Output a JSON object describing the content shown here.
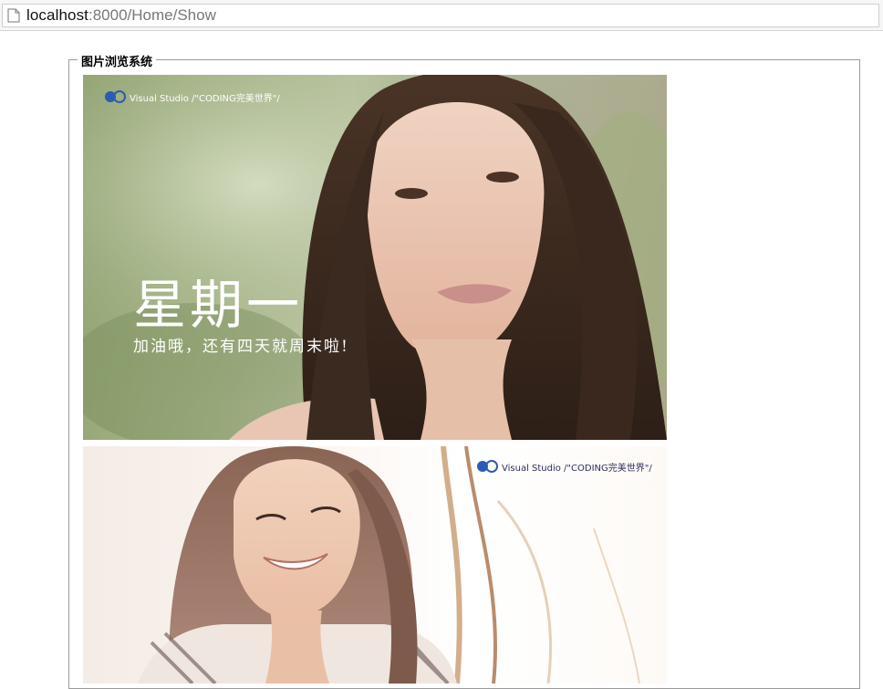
{
  "browser": {
    "url_host": "localhost",
    "url_rest": ":8000/Home/Show"
  },
  "page": {
    "legend": "图片浏览系统"
  },
  "photos": [
    {
      "logo_text": "Visual Studio /\"CODING完美世界\"/",
      "headline": "星期一",
      "subline": "加油哦，还有四天就周末啦!"
    },
    {
      "logo_text": "Visual Studio /\"CODING完美世界\"/"
    }
  ]
}
